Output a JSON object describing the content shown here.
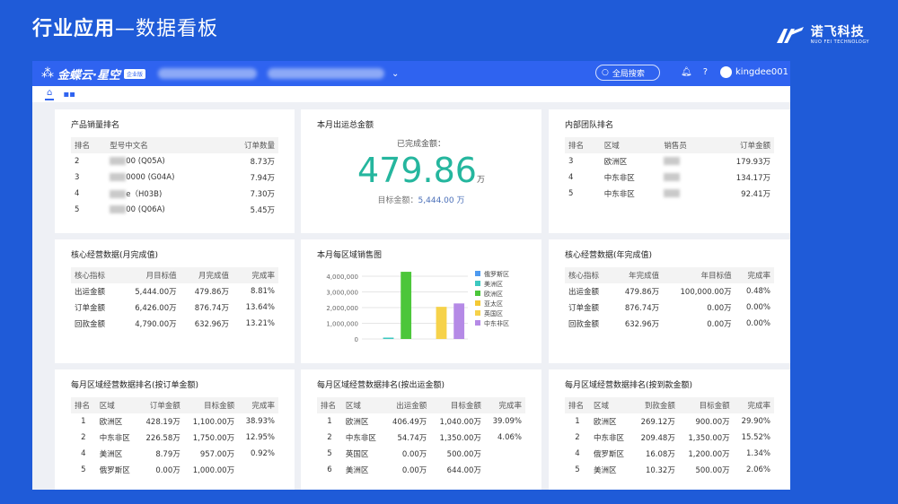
{
  "slide": {
    "title_bold": "行业应用",
    "title_rest": "—数据看板"
  },
  "logo": {
    "cn": "诺飞科技",
    "en": "NUO FEI TECHNOLOGY"
  },
  "app": {
    "brand": "金蝶云·星空",
    "version": "企业版",
    "search": "全局搜索",
    "user": "kingdee001"
  },
  "cards": {
    "product_rank": {
      "title": "产品销量排名",
      "headers": [
        "排名",
        "型号中文名",
        "订单数量"
      ],
      "rows": [
        [
          "2",
          "00 (Q05A)",
          "8.73万"
        ],
        [
          "3",
          "0000 (G04A)",
          "7.94万"
        ],
        [
          "4",
          "e（H03B)",
          "7.30万"
        ],
        [
          "5",
          "00 (Q06A)",
          "5.45万"
        ]
      ]
    },
    "shipment_total": {
      "title": "本月出运总金额",
      "done_label": "已完成金额：",
      "value": "479.86",
      "unit": "万",
      "target_label": "目标金额：",
      "target_value": "5,444.00 万"
    },
    "team_rank": {
      "title": "内部团队排名",
      "headers": [
        "排名",
        "区域",
        "销售员",
        "订单金额"
      ],
      "rows": [
        [
          "3",
          "欧洲区",
          "",
          "179.93万"
        ],
        [
          "4",
          "中东非区",
          "",
          "134.17万"
        ],
        [
          "5",
          "中东非区",
          "",
          "92.41万"
        ]
      ]
    },
    "core_month": {
      "title": "核心经营数据(月完成值)",
      "headers": [
        "核心指标",
        "月目标值",
        "月完成值",
        "完成率"
      ],
      "rows": [
        [
          "出运金额",
          "5,444.00万",
          "479.86万",
          "8.81%"
        ],
        [
          "订单金额",
          "6,426.00万",
          "876.74万",
          "13.64%"
        ],
        [
          "回款金额",
          "4,790.00万",
          "632.96万",
          "13.21%"
        ]
      ]
    },
    "region_sales": {
      "title": "本月每区域销售图"
    },
    "core_year": {
      "title": "核心经营数据(年完成值)",
      "headers": [
        "核心指标",
        "年完成值",
        "年目标值",
        "完成率"
      ],
      "rows": [
        [
          "出运金额",
          "479.86万",
          "100,000.00万",
          "0.48%"
        ],
        [
          "订单金额",
          "876.74万",
          "0.00万",
          "0.00%"
        ],
        [
          "回款金额",
          "632.96万",
          "0.00万",
          "0.00%"
        ]
      ]
    },
    "rank_order": {
      "title": "每月区域经营数据排名(按订单金额)",
      "headers": [
        "排名",
        "区域",
        "订单金额",
        "目标金额",
        "完成率"
      ],
      "rows": [
        [
          "1",
          "欧洲区",
          "428.19万",
          "1,100.00万",
          "38.93%"
        ],
        [
          "2",
          "中东非区",
          "226.58万",
          "1,750.00万",
          "12.95%"
        ],
        [
          "4",
          "美洲区",
          "8.79万",
          "957.00万",
          "0.92%"
        ],
        [
          "5",
          "俄罗斯区",
          "0.00万",
          "1,000.00万",
          ""
        ]
      ]
    },
    "rank_ship": {
      "title": "每月区域经营数据排名(按出运金额)",
      "headers": [
        "排名",
        "区域",
        "出运金额",
        "目标金额",
        "完成率"
      ],
      "rows": [
        [
          "1",
          "欧洲区",
          "406.49万",
          "1,040.00万",
          "39.09%"
        ],
        [
          "2",
          "中东非区",
          "54.74万",
          "1,350.00万",
          "4.06%"
        ],
        [
          "5",
          "英国区",
          "0.00万",
          "500.00万",
          ""
        ],
        [
          "6",
          "美洲区",
          "0.00万",
          "644.00万",
          ""
        ]
      ]
    },
    "rank_collect": {
      "title": "每月区域经营数据排名(按到款金额)",
      "headers": [
        "排名",
        "区域",
        "到款金额",
        "目标金额",
        "完成率"
      ],
      "rows": [
        [
          "1",
          "欧洲区",
          "269.12万",
          "900.00万",
          "29.90%"
        ],
        [
          "2",
          "中东非区",
          "209.48万",
          "1,350.00万",
          "15.52%"
        ],
        [
          "4",
          "俄罗斯区",
          "16.08万",
          "1,200.00万",
          "1.34%"
        ],
        [
          "5",
          "美洲区",
          "10.32万",
          "500.00万",
          "2.06%"
        ]
      ]
    }
  },
  "chart_data": {
    "type": "bar",
    "title": "本月每区域销售图",
    "ylim": [
      0,
      4000000
    ],
    "yticks": [
      "0",
      "1,000,000",
      "2,000,000",
      "3,000,000",
      "4,000,000"
    ],
    "legend_position": "right",
    "series": [
      {
        "name": "俄罗斯区",
        "color": "#4e9af0",
        "value": 0
      },
      {
        "name": "美洲区",
        "color": "#3dc8c0",
        "value": 87900
      },
      {
        "name": "欧洲区",
        "color": "#4cc63a",
        "value": 4281900
      },
      {
        "name": "亚太区",
        "color": "#f4c934",
        "value": 0
      },
      {
        "name": "英国区",
        "color": "#f6d24a",
        "value": 2050000
      },
      {
        "name": "中东非区",
        "color": "#b58ae6",
        "value": 2265800
      }
    ]
  }
}
